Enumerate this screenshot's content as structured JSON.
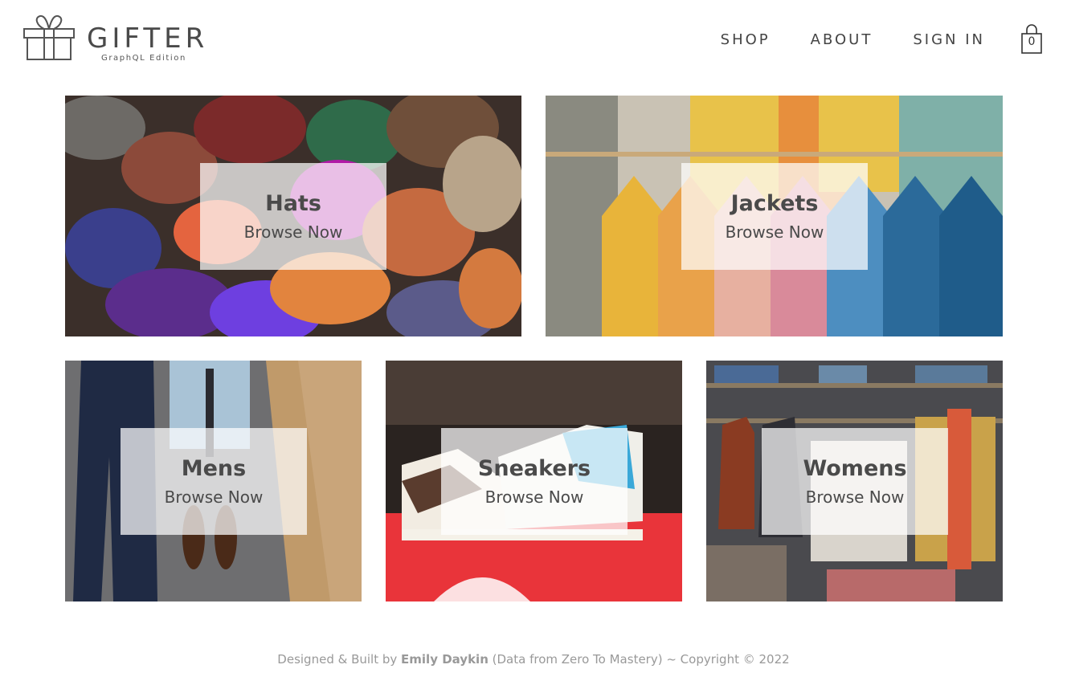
{
  "header": {
    "logo": {
      "word": "GIFTER",
      "subtitle": "GraphQL Edition"
    },
    "nav": [
      {
        "label": "SHOP"
      },
      {
        "label": "ABOUT"
      },
      {
        "label": "SIGN IN"
      }
    ],
    "cart": {
      "count": "0",
      "icon": "shopping-bag-icon"
    }
  },
  "categories": [
    {
      "title": "Hats",
      "cta": "Browse Now"
    },
    {
      "title": "Jackets",
      "cta": "Browse Now"
    },
    {
      "title": "Mens",
      "cta": "Browse Now"
    },
    {
      "title": "Sneakers",
      "cta": "Browse Now"
    },
    {
      "title": "Womens",
      "cta": "Browse Now"
    }
  ],
  "footer": {
    "prefix": "Designed & Built by ",
    "author": "Emily Daykin",
    "suffix": " (Data from Zero To Mastery) ~ Copyright © 2022"
  },
  "colors": {
    "text": "#444444",
    "footer_text": "#999999",
    "card_overlay": "#ffffff"
  }
}
